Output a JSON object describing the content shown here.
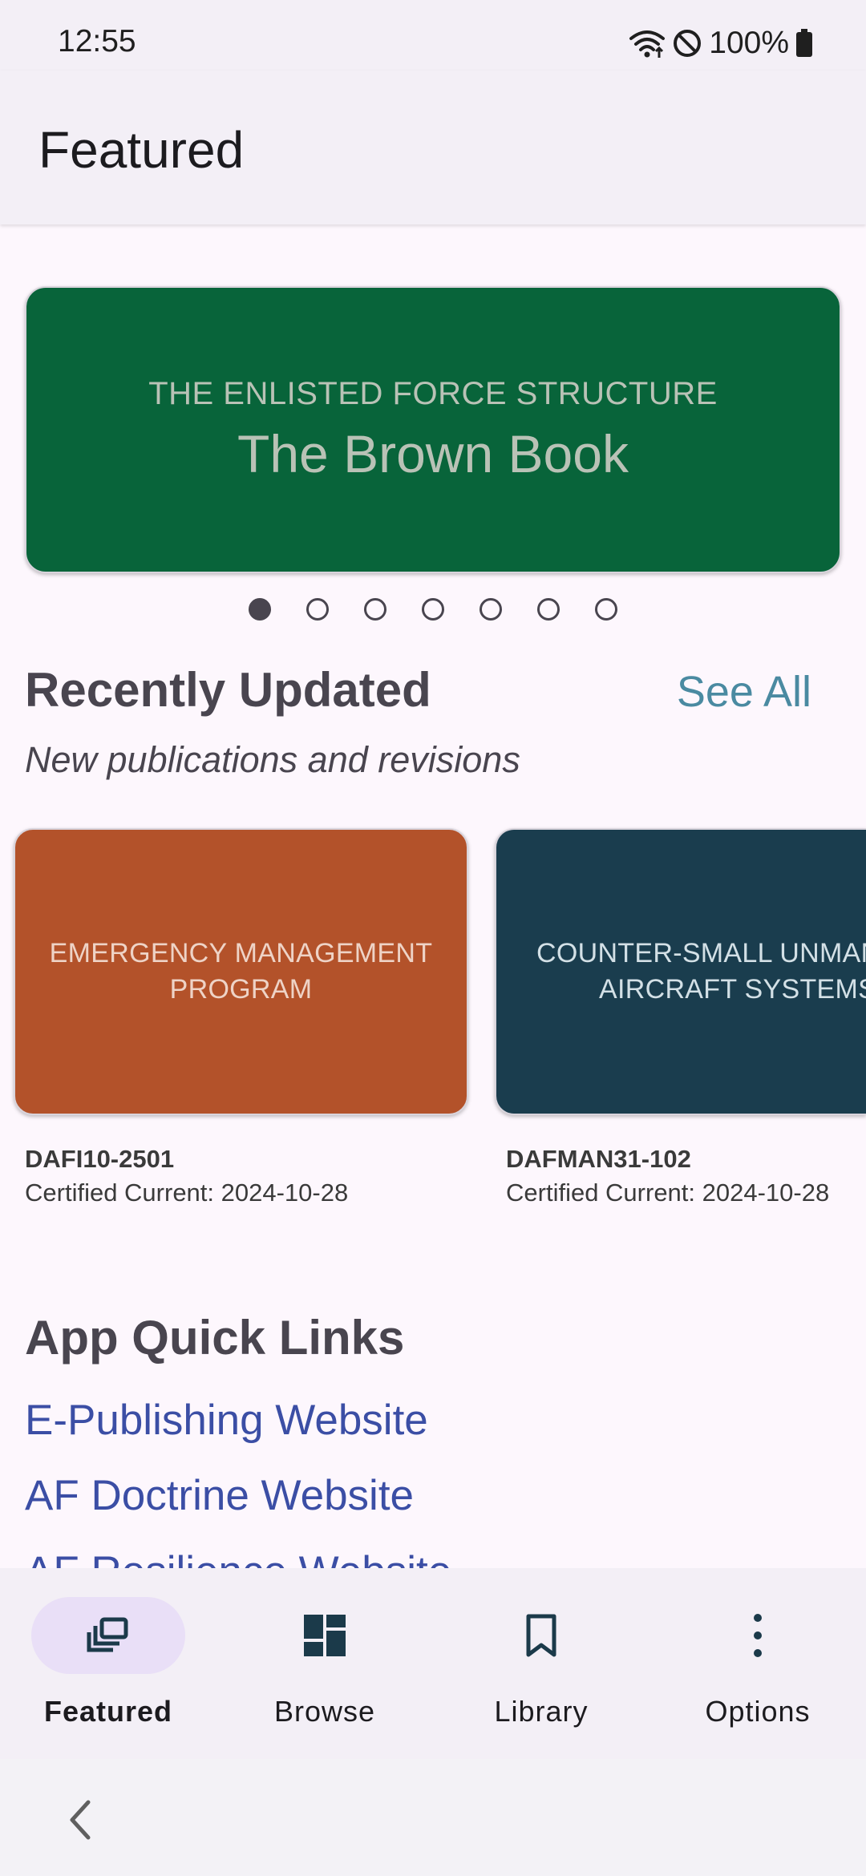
{
  "status_bar": {
    "time": "12:55",
    "battery_text": "100%",
    "icons": [
      "wifi-icon",
      "do-not-disturb-icon",
      "battery-icon"
    ]
  },
  "app_bar": {
    "title": "Featured"
  },
  "hero": {
    "subtitle": "THE ENLISTED FORCE STRUCTURE",
    "title": "The Brown Book",
    "background": "#08643a",
    "text_color": "#b9c2b6"
  },
  "carousel": {
    "count": 7,
    "active_index": 0
  },
  "recently_updated": {
    "title": "Recently Updated",
    "see_all": "See All",
    "subtitle": "New publications and revisions",
    "cards": [
      {
        "cover_text": "EMERGENCY MANAGEMENT\nPROGRAM",
        "id": "DAFI10-2501",
        "certified": "Certified Current: 2024-10-28",
        "color": "#b3522a",
        "text_color": "#eed3c6"
      },
      {
        "cover_text": "COUNTER-SMALL UNMANNED\nAIRCRAFT SYSTEMS",
        "id": "DAFMAN31-102",
        "certified": "Certified Current: 2024-10-28",
        "color": "#1a3d4e",
        "text_color": "#d3e0e6"
      }
    ]
  },
  "quick_links": {
    "title": "App Quick Links",
    "links": [
      "E-Publishing Website",
      "AF Doctrine Website",
      "AF Resilience Website"
    ]
  },
  "bottom_nav": {
    "active": "Featured",
    "items": [
      {
        "label": "Featured",
        "icon": "featured-icon"
      },
      {
        "label": "Browse",
        "icon": "dashboard-icon"
      },
      {
        "label": "Library",
        "icon": "bookmark-icon"
      },
      {
        "label": "Options",
        "icon": "more-vert-icon"
      }
    ],
    "active_pill_color": "#e9dff7",
    "icon_color": "#1b3a4a"
  }
}
